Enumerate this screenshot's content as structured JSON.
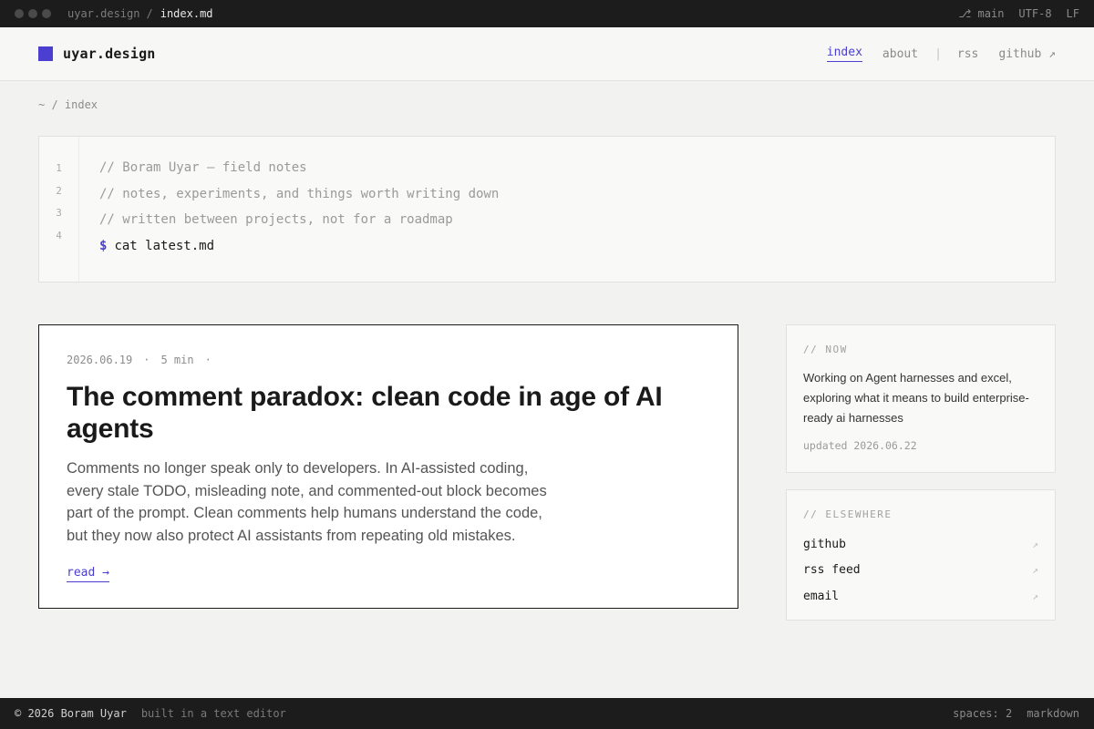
{
  "titlebar": {
    "path": "uyar.design",
    "separator": "/",
    "file": "index.md",
    "branch_icon": "⎇",
    "branch": "main",
    "encoding": "UTF-8",
    "line_ending": "LF"
  },
  "header": {
    "logo_text": "uyar.design",
    "nav": {
      "index": "index",
      "about": "about",
      "divider": "|",
      "rss": "rss",
      "github": "github ↗"
    }
  },
  "breadcrumb": "~ / index",
  "codeblock": {
    "line_numbers": [
      "1",
      "2",
      "3",
      "4"
    ],
    "lines": [
      "// Boram Uyar — field notes",
      "// notes, experiments, and things worth writing down",
      "// written between projects, not for a roadmap"
    ],
    "prompt_symbol": "$",
    "command": "cat latest.md"
  },
  "article": {
    "date": "2026.06.19",
    "dot": "·",
    "read_time": "5 min",
    "title": "The comment paradox: clean code in age of AI agents",
    "excerpt": "Comments no longer speak only to developers. In AI-assisted coding, every stale TODO, misleading note, and commented-out block becomes part of the prompt. Clean comments help humans understand the code, but they now also protect AI assistants from repeating old mistakes.",
    "read_label": "read →"
  },
  "now_panel": {
    "label": "// NOW",
    "text": "Working on Agent harnesses and excel, exploring what it means to build enterprise-ready ai harnesses",
    "updated": "updated 2026.06.22"
  },
  "elsewhere_panel": {
    "label": "// ELSEWHERE",
    "links": [
      {
        "label": "github",
        "arrow": "↗"
      },
      {
        "label": "rss feed",
        "arrow": "↗"
      },
      {
        "label": "email",
        "arrow": "↗"
      }
    ]
  },
  "footer": {
    "copyright": "© 2026 Boram Uyar",
    "built": "built in a text editor",
    "spaces": "spaces: 2",
    "mode": "markdown"
  },
  "colors": {
    "accent": "#4a3fd0",
    "bar_bg": "#1c1c1c",
    "page_bg": "#f2f2f0"
  }
}
